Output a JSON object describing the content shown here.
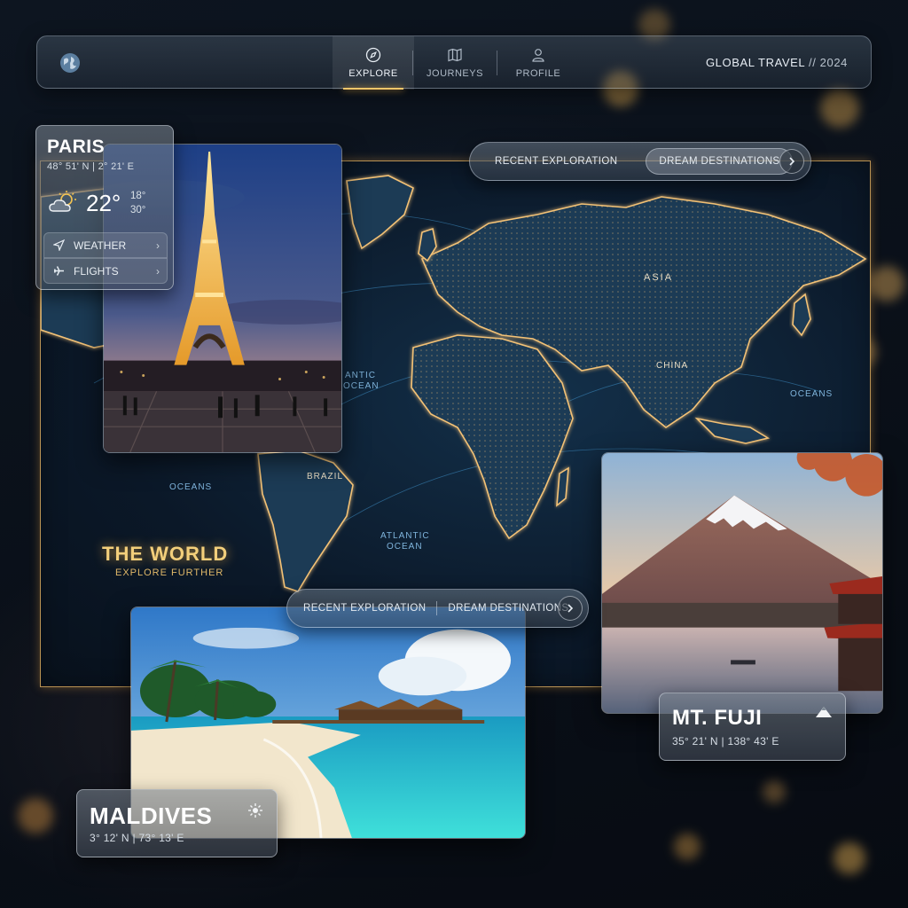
{
  "nav": {
    "tabs": [
      {
        "label": "EXPLORE",
        "icon": "compass-icon",
        "active": true
      },
      {
        "label": "JOURNEYS",
        "icon": "map-icon",
        "active": false
      },
      {
        "label": "PROFILE",
        "icon": "user-icon",
        "active": false
      }
    ],
    "brand": "GLOBAL TRAVEL",
    "brand_sep": "//",
    "year": "2024"
  },
  "top_pill": {
    "recent": "RECENT EXPLORATION",
    "dream": "DREAM DESTINATIONS"
  },
  "bottom_pill": {
    "recent": "RECENT EXPLORATION",
    "dream": "DREAM DESTINATIONS"
  },
  "map": {
    "title": "THE WORLD",
    "subtitle": "EXPLORE FURTHER",
    "labels": [
      "ASIA",
      "CHINA",
      "OCEANS",
      "BRAZIL",
      "OCEANS",
      "ATLANTIC",
      "OCEAN",
      "ANTIC",
      "OCEAN"
    ]
  },
  "paris": {
    "city": "PARIS",
    "coords": "48° 51' N | 2° 21' E",
    "temp": "22°",
    "temp_low": "18°",
    "temp_high": "30°",
    "weather_label": "WEATHER",
    "flights_label": "FLIGHTS"
  },
  "fuji": {
    "city": "MT. FUJI",
    "coords": "35° 21' N | 138° 43' E"
  },
  "maldives": {
    "city": "MALDIVES",
    "coords": "3° 12' N | 73° 13' E"
  },
  "colors": {
    "accent": "#f6c66a",
    "map_glow": "#f3c276",
    "ocean_label": "#7fb4dc"
  }
}
